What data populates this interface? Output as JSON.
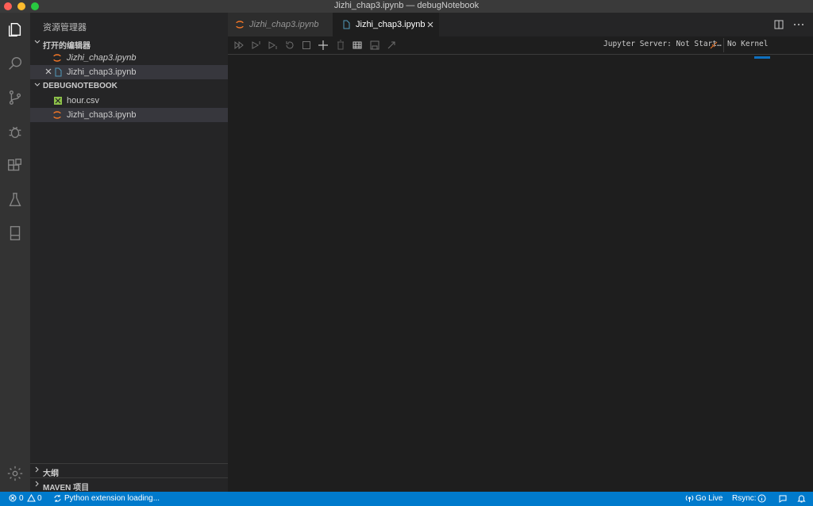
{
  "window": {
    "title": "Jizhi_chap3.ipynb — debugNotebook"
  },
  "sidebar": {
    "header": "资源管理器",
    "open_editors": {
      "title": "打开的编辑器",
      "items": [
        {
          "label": "Jizhi_chap3.ipynb",
          "icon": "jupyter-icon"
        },
        {
          "label": "Jizhi_chap3.ipynb",
          "icon": "file-icon"
        }
      ]
    },
    "workspace": {
      "title": "DEBUGNOTEBOOK",
      "items": [
        {
          "label": "hour.csv",
          "icon": "csv-file-icon"
        },
        {
          "label": "Jizhi_chap3.ipynb",
          "icon": "jupyter-icon"
        }
      ]
    },
    "outline": {
      "title": "大纲"
    },
    "maven": {
      "title": "MAVEN 项目"
    }
  },
  "tabs": [
    {
      "label": "Jizhi_chap3.ipynb",
      "active": false
    },
    {
      "label": "Jizhi_chap3.ipynb",
      "active": true
    }
  ],
  "notebook_toolbar": {
    "server_status": "Jupyter Server: Not Start…",
    "kernel": "No Kernel"
  },
  "statusbar": {
    "errors": "0",
    "warnings": "0",
    "python_status": "Python extension loading...",
    "go_live": "Go Live",
    "rsync": "Rsync:"
  },
  "colors": {
    "statusbar": "#007acc",
    "activity_bar": "#333333",
    "sidebar": "#252526",
    "editor": "#1e1e1e",
    "jupyter": "#f37626"
  }
}
